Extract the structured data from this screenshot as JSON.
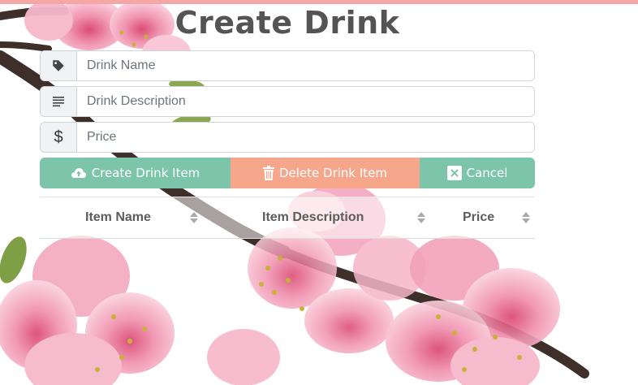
{
  "page": {
    "title": "Create Drink"
  },
  "form": {
    "name": {
      "placeholder": "Drink Name",
      "value": "",
      "icon": "tag-icon"
    },
    "description": {
      "placeholder": "Drink Description",
      "value": "",
      "icon": "lines-icon"
    },
    "price": {
      "placeholder": "Price",
      "value": "",
      "icon": "$"
    }
  },
  "buttons": {
    "create": {
      "label": "Create Drink Item",
      "icon": "cloud-upload-icon",
      "color": "#7cc4aa"
    },
    "delete": {
      "label": "Delete Drink Item",
      "icon": "trash-icon",
      "color": "#f6a68b"
    },
    "cancel": {
      "label": "Cancel",
      "icon": "close-box-icon",
      "color": "#7cc4aa"
    }
  },
  "table": {
    "columns": [
      "Item Name",
      "Item Description",
      "Price"
    ],
    "rows": []
  },
  "colors": {
    "accent_bar": "#f4a7a6",
    "title": "#545454"
  }
}
